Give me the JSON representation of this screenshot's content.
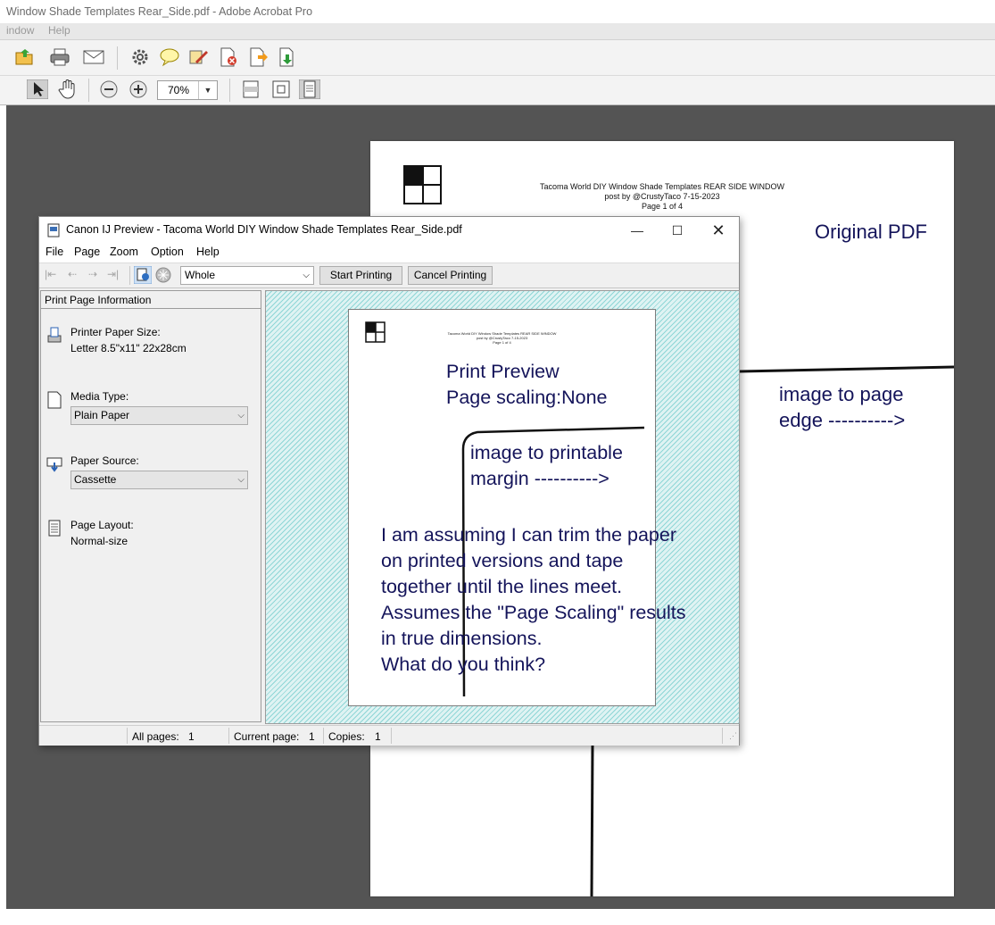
{
  "acrobat": {
    "window_title": "Window Shade Templates Rear_Side.pdf - Adobe Acrobat Pro",
    "menu": [
      "indow",
      "Help"
    ],
    "zoom": "70%"
  },
  "pdf_page": {
    "header_line1": "Tacoma World DIY Window Shade Templates REAR SIDE WINDOW",
    "header_line2": "post by @CrustyTaco   7-15-2023",
    "header_line3": "Page 1 of 4",
    "note_original": "Original PDF",
    "note_edge_line1": "image to page",
    "note_edge_line2": "edge  ---------->"
  },
  "canon": {
    "title": "Canon IJ Preview - Tacoma World DIY Window Shade Templates Rear_Side.pdf",
    "menu": [
      "File",
      "Page",
      "Zoom",
      "Option",
      "Help"
    ],
    "view_mode": "Whole",
    "start_printing": "Start Printing",
    "cancel_printing": "Cancel Printing",
    "panel_header": "Print Page Information",
    "paper_size_label": "Printer Paper Size:",
    "paper_size_value": "Letter 8.5\"x11\" 22x28cm",
    "media_type_label": "Media Type:",
    "media_type_value": "Plain Paper",
    "paper_source_label": "Paper Source:",
    "paper_source_value": "Cassette",
    "page_layout_label": "Page Layout:",
    "page_layout_value": "Normal-size",
    "preview_header_line1": "Tacoma World DIY Window Shade Templates REAR SIDE WINDOW",
    "preview_header_line2": "post by @CrustyTaco   7-15-2023",
    "preview_header_line3": "Page 1 of 4",
    "status": {
      "all_pages_label": "All pages:",
      "all_pages": "1",
      "current_page_label": "Current page:",
      "current_page": "1",
      "copies_label": "Copies:",
      "copies": "1"
    }
  },
  "annotations": {
    "preview_line1": "Print Preview",
    "preview_line2": "Page scaling:None",
    "margin_line1": "image to printable",
    "margin_line2": "margin  ---------->",
    "body": [
      "I am assuming I can trim the paper",
      "on printed versions and tape",
      "together until the lines meet.",
      "Assumes the \"Page Scaling\" results",
      "in true dimensions.",
      "What do you think?"
    ]
  },
  "colors": {
    "annotation_text": "#14145a",
    "workspace": "#545454",
    "preview_hatch": "#8fd6d6"
  }
}
